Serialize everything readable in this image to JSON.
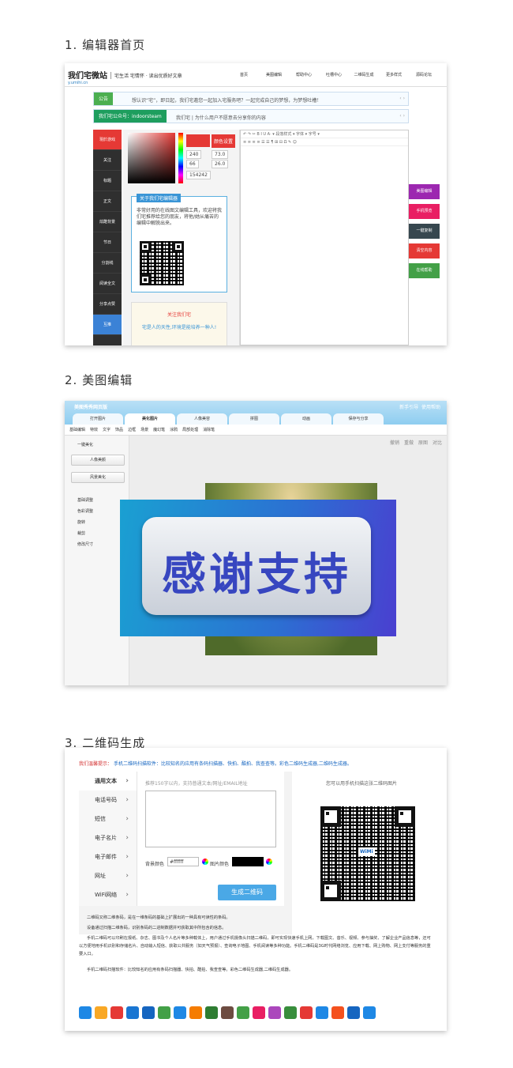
{
  "section1": {
    "heading": "1. 编辑器首页",
    "logo": "我们宅微站",
    "logo_sub": "y.umihi.cn",
    "slogan": "宅生活 宅情怀 · 读出优质好文章",
    "nav": [
      "首页",
      "美图编辑",
      "帮助中心",
      "吐槽中心",
      "二维码生成",
      "更多样式",
      "源码论坛"
    ],
    "notice_label": "公告",
    "notice_text": "想认识“宅”，即日起，我们宅邀您一起加入宅服务吧？一起完成自己的梦想，为梦想吐槽！",
    "wechat_label": "我们宅公众号：indoorsteam",
    "wechat_text": "我们宅 | 为什么用户不愿意去分享你的内容",
    "sidebar": [
      "現於游戏",
      "关注",
      "标题",
      "正文",
      "炫酷背景",
      "节日",
      "分割线",
      "阅读全文",
      "分享点赞",
      "互推"
    ],
    "color_btn": "颜色设置",
    "color_vals": [
      "240",
      "73.0",
      "66",
      "26.0",
      "154242"
    ],
    "card_title": "关于我们宅编辑器",
    "card_text": "非常好用的在线图文编辑工具，欢迎将我们宅推荐给您的朋友，将他/她从痛苦的编辑中解脱出来。",
    "card2_title": "关注我们宅",
    "card2_text": "宅是人的天性,环境是能培养一种人!",
    "toolbar1": "↶ ↷ ✂ B I U A· ▾ 段落样式 ▾ 字体 ▾ 字号 ▾",
    "toolbar2": "≡ ≡ ≡ ≡ ☰ ☰ ¶ ⊞ ⊟ Ω ✎ ☺",
    "side_buttons": [
      "美图编辑",
      "手机预览",
      "一键复制",
      "清空内容",
      "在线帮助"
    ]
  },
  "section2": {
    "heading": "2. 美图编辑",
    "app_title": "美图秀秀网页版",
    "top_right": [
      "新手引导",
      "使用帮助"
    ],
    "tabs": [
      "打开图片",
      "美化图片",
      "人像美容",
      "拼图",
      "动画",
      "保存与分享"
    ],
    "tools": [
      "基础编辑",
      "特效",
      "文字",
      "饰品",
      "边框",
      "场景",
      "魔幻笔",
      "涂鸦",
      "局部处理",
      "消除笔"
    ],
    "edit_actions": [
      "撤销",
      "重做",
      "原图",
      "对比"
    ],
    "one_click": "一键美化",
    "btn_portrait": "人像美颜",
    "btn_scene": "风景美化",
    "menu": [
      "基础调整",
      "色彩调整",
      "旋转",
      "裁剪",
      "修改尺寸"
    ],
    "overlay_text": "感谢支持"
  },
  "section3": {
    "heading": "3. 二维码生成",
    "tip": "我们温馨提示：",
    "tip_text": "手机二维码扫描软件：比较知名的应用有条码扫描器、快拍、酷拍、我查查等。彩色二维码生成器,二维码生成器。",
    "types": [
      "通用文本",
      "电话号码",
      "短信",
      "电子名片",
      "电子邮件",
      "网址",
      "WiFi网络"
    ],
    "placeholder": "推荐150字以内，支持普通文本/网址/EMAIL地址",
    "bg_label": "背景颜色",
    "bg_value": "#ffffff",
    "fg_label": "图片颜色",
    "gen_btn": "生成二维码",
    "scan_hint": "您可以用手机扫描这张二维码图片",
    "qr_logo": "WiMi",
    "paragraphs": [
      "二维码又称二维条码，是在一维条码的基础上扩展出的一种具有可读性的条码。",
      "设备通过扫描二维条码，识别条码的二进制数据并可获取其中所包含的信息。",
      "手机二维码可以印刷在报纸、杂志、图书及个人名片等多种载体上，用户通过手机摄像头扫描二维码，即可实现快速手机上网，下载图文、音乐、视频、参与抽奖、了解企业产品信息等，还可以方便地用手机识别和存储名片、自动输入短信、获取公共服务（如天气预报）、查询电子地图、手机阅读等多种功能。手机二维码是3G时代网络浏览、应用下载、网上购物、网上支付等服务的重要入口。",
      "手机二维码扫描软件：比较知名的应用有条码扫描器、快拍、酷拍、我查查等。彩色二维码生成器,二维码生成器。"
    ],
    "icon_colors": [
      "#1e88e5",
      "#f9a825",
      "#e53935",
      "#1976d2",
      "#1565c0",
      "#43a047",
      "#1e88e5",
      "#f57c00",
      "#2e7d32",
      "#6d4c41",
      "#43a047",
      "#e91e63",
      "#ab47bc",
      "#388e3c",
      "#e53935",
      "#1e88e5",
      "#f4511e",
      "#1565c0",
      "#1e88e5"
    ]
  }
}
